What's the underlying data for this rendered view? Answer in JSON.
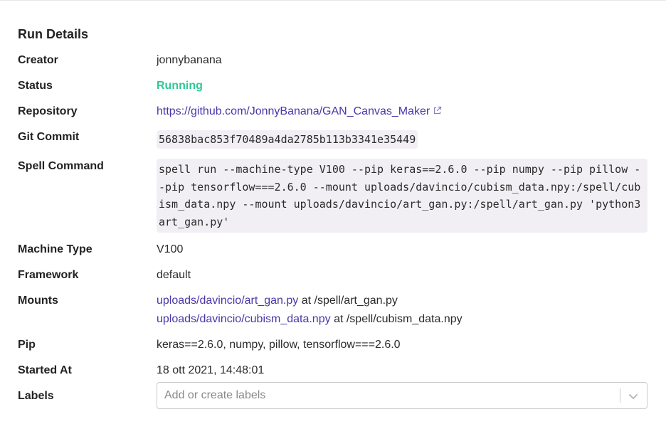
{
  "section_title": "Run Details",
  "fields": {
    "creator": {
      "label": "Creator",
      "value": "jonnybanana"
    },
    "status": {
      "label": "Status",
      "value": "Running"
    },
    "repository": {
      "label": "Repository",
      "value": "https://github.com/JonnyBanana/GAN_Canvas_Maker"
    },
    "git_commit": {
      "label": "Git Commit",
      "value": "56838bac853f70489a4da2785b113b3341e35449"
    },
    "spell_command": {
      "label": "Spell Command",
      "value": "spell run --machine-type V100 --pip keras==2.6.0 --pip numpy --pip pillow --pip tensorflow===2.6.0 --mount uploads/davincio/cubism_data.npy:/spell/cubism_data.npy --mount uploads/davincio/art_gan.py:/spell/art_gan.py 'python3 art_gan.py'"
    },
    "machine_type": {
      "label": "Machine Type",
      "value": "V100"
    },
    "framework": {
      "label": "Framework",
      "value": "default"
    },
    "mounts": {
      "label": "Mounts",
      "items": [
        {
          "source": "uploads/davincio/art_gan.py",
          "joiner": "at",
          "target": "/spell/art_gan.py"
        },
        {
          "source": "uploads/davincio/cubism_data.npy",
          "joiner": "at",
          "target": "/spell/cubism_data.npy"
        }
      ]
    },
    "pip": {
      "label": "Pip",
      "value": "keras==2.6.0, numpy, pillow, tensorflow===2.6.0"
    },
    "started_at": {
      "label": "Started At",
      "value": "18 ott 2021, 14:48:01"
    },
    "labels": {
      "label": "Labels",
      "placeholder": "Add or create labels"
    }
  },
  "colors": {
    "link": "#4b35a8",
    "status_running": "#2ec995",
    "code_background": "#f1eff4"
  },
  "icons": {
    "repository_link": "external-link-icon",
    "labels_dropdown": "chevron-down-icon"
  }
}
